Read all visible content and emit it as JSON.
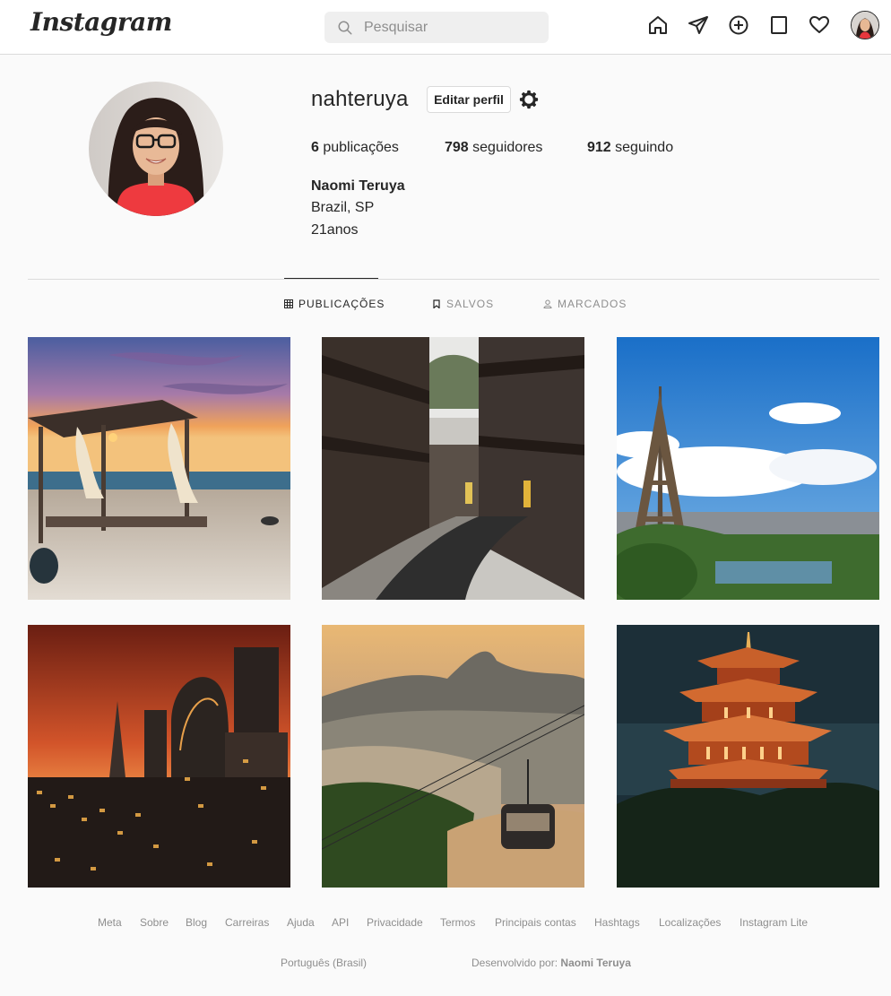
{
  "topbar": {
    "logo": "Instagram",
    "search_placeholder": "Pesquisar",
    "icons": [
      "home-icon",
      "direct-icon",
      "new-post-icon",
      "explore-icon",
      "activity-icon"
    ]
  },
  "profile": {
    "username": "nahteruya",
    "edit_label": "Editar perfil",
    "stats": {
      "posts_count": "6",
      "posts_label": "publicações",
      "followers_count": "798",
      "followers_label": "seguidores",
      "following_count": "912",
      "following_label": "seguindo"
    },
    "full_name": "Naomi Teruya",
    "bio": [
      "Brazil, SP",
      "21anos"
    ]
  },
  "tabs": [
    {
      "label": "PUBLICAÇÕES",
      "icon": "grid-icon",
      "active": true
    },
    {
      "label": "SALVOS",
      "icon": "bookmark-icon",
      "active": false
    },
    {
      "label": "MARCADOS",
      "icon": "tagged-user-icon",
      "active": false
    }
  ],
  "posts": [
    "beach-cabana-sunset",
    "japanese-street",
    "eiffel-tower",
    "london-skyline",
    "rio-cable-car",
    "chinese-pagoda"
  ],
  "footer": {
    "links": [
      "Meta",
      "Sobre",
      "Blog",
      "Carreiras",
      "Ajuda",
      "API",
      "Privacidade",
      "Termos",
      "Principais contas",
      "Hashtags",
      "Localizações",
      "Instagram Lite"
    ],
    "language": "Português (Brasil)",
    "credit_prefix": "Desenvolvido por:",
    "credit_name": "Naomi Teruya"
  },
  "colors": {
    "background": "#fafafa",
    "text": "#262626",
    "muted": "#8e8e8e",
    "border": "#dbdbdb"
  }
}
